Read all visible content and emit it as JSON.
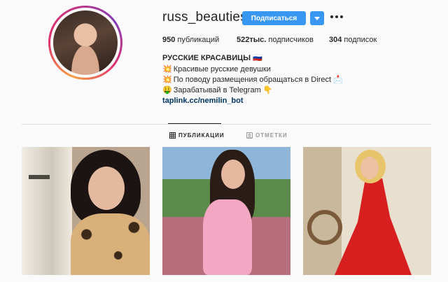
{
  "profile": {
    "username": "russ_beauties",
    "follow_label": "Подписаться",
    "posts_count": "950",
    "posts_label": "публикаций",
    "followers_count": "522тыс.",
    "followers_label": "подписчиков",
    "following_count": "304",
    "following_label": "подписок"
  },
  "bio": {
    "name": "РУССКИЕ КРАСАВИЦЫ 🇷🇺",
    "line1_emoji": "💥",
    "line1": "Красивые русские девушки",
    "line2_emoji": "💥",
    "line2": "По поводу размещения обращаться в Direct 📩",
    "line3_emoji": "🤑",
    "line3": "Зарабатывай в Telegram 👇",
    "link": "taplink.cc/nemilin_bot"
  },
  "tabs": [
    {
      "label": "ПУБЛИКАЦИИ",
      "active": true,
      "icon": "grid-icon"
    },
    {
      "label": "ОТМЕТКИ",
      "active": false,
      "icon": "tag-icon"
    }
  ],
  "colors": {
    "accent": "#3897f0",
    "link": "#003569",
    "text": "#262626",
    "background": "#fafafa"
  }
}
